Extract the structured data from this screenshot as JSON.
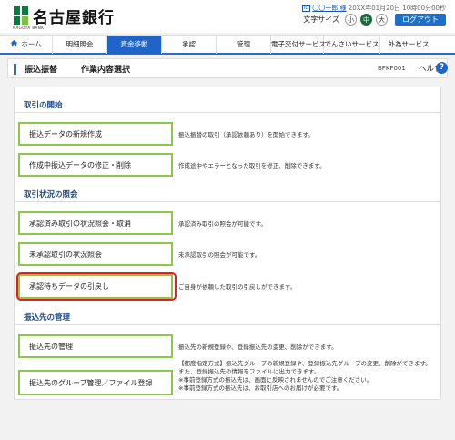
{
  "header": {
    "bank_name": "名古屋銀行",
    "logo_sub": "NAGOYA BANK",
    "user_icon": "ID",
    "user_name": "〇〇一郎 様",
    "last_login": "20XX年01月20日 10時00分00秒",
    "font_size_label": "文字サイズ",
    "font_small": "小",
    "font_medium": "中",
    "font_large": "大",
    "logout": "ログアウト"
  },
  "nav": {
    "items": [
      {
        "label": "ホーム",
        "icon": "home-icon"
      },
      {
        "label": "明細照会"
      },
      {
        "label": "資金移動"
      },
      {
        "label": "承認"
      },
      {
        "label": "管理"
      },
      {
        "label": "電子交付サービス"
      },
      {
        "label": "でんさいサービス"
      },
      {
        "label": "外為サービス"
      }
    ],
    "active_index": 2,
    "accent_color": "#1f64c6"
  },
  "page": {
    "title": "振込振替",
    "subtitle": "作業内容選択",
    "screen_code": "BFKF001",
    "help_label": "ヘルプ",
    "help_icon": "?"
  },
  "sections": [
    {
      "title": "取引の開始",
      "items": [
        {
          "label": "振込データの新規作成",
          "desc": "振込振替の取引（承認依頼あり）を開始できます。"
        },
        {
          "label": "作成中振込データの修正・削除",
          "desc": "作成途中やエラーとなった取引を修正、削除できます。"
        }
      ]
    },
    {
      "title": "取引状況の照会",
      "items": [
        {
          "label": "承認済み取引の状況照会・取消",
          "desc": "承認済み取引の照会が可能です。"
        },
        {
          "label": "未承認取引の状況照会",
          "desc": "未承認取引の照会が可能です。"
        },
        {
          "label": "承認待ちデータの引戻し",
          "desc": "ご自身が依頼した取引の引戻しができます。",
          "highlighted": true
        }
      ]
    },
    {
      "title": "振込先の管理",
      "items": [
        {
          "label": "振込先の管理",
          "desc": "振込先の新規登録や、登録振込先の変更、削除ができます。"
        },
        {
          "label": "振込先のグループ管理／ファイル登録",
          "desc_lines": [
            "【都度指定方式】振込先グループの新規登録や、登録振込先グループの変更、削除ができます。",
            "また、登録振込先の情報をファイルに出力できます。",
            "※事前登録方式の振込先は、画面に反映されませんのでご注意ください。",
            "※事前登録方式の振込先は、お取引店へのお届けが必要です。"
          ]
        }
      ]
    }
  ]
}
